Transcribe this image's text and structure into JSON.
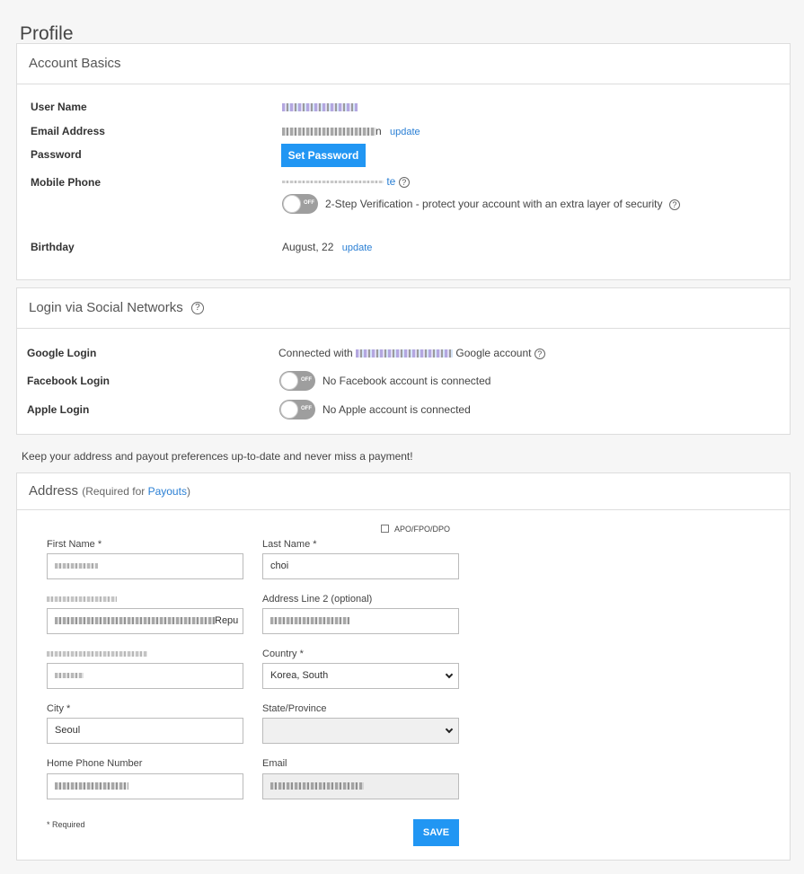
{
  "page_title": "Profile",
  "account": {
    "title": "Account Basics",
    "username_label": "User Name",
    "email_label": "Email Address",
    "email_suffix": "n",
    "email_update": "update",
    "password_label": "Password",
    "set_password": "Set Password",
    "mobile_label": "Mobile Phone",
    "mobile_suffix": "te",
    "two_step_text": "2-Step Verification - protect your account with an extra layer of security",
    "toggle_off": "OFF",
    "birthday_label": "Birthday",
    "birthday_value": "August, 22",
    "birthday_update": "update"
  },
  "social": {
    "title": "Login via Social Networks",
    "google_label": "Google Login",
    "google_prefix": "Connected with",
    "google_suffix": "Google account",
    "facebook_label": "Facebook Login",
    "facebook_status": "No Facebook account is connected",
    "apple_label": "Apple Login",
    "apple_status": "No Apple account is connected",
    "toggle_off": "OFF"
  },
  "notice": "Keep your address and payout preferences up-to-date and never miss a payment!",
  "address": {
    "title": "Address",
    "required_prefix": "(Required for ",
    "payouts_link": "Payouts",
    "required_suffix": ")",
    "apo_label": "APO/FPO/DPO",
    "first_name_label": "First Name *",
    "last_name_label": "Last Name *",
    "last_name_value": "choi",
    "address2_label": "Address Line 2 (optional)",
    "address1_partial": "Repu",
    "country_label": "Country *",
    "country_value": "Korea, South",
    "city_label": "City *",
    "city_value": "Seoul",
    "state_label": "State/Province",
    "state_value": "",
    "home_phone_label": "Home Phone Number",
    "email_label": "Email",
    "required_note": "* Required",
    "save_label": "SAVE"
  },
  "colors": {
    "accent": "#2196f3",
    "link": "#2a7fd4",
    "toggle_off": "#9e9e9e"
  }
}
